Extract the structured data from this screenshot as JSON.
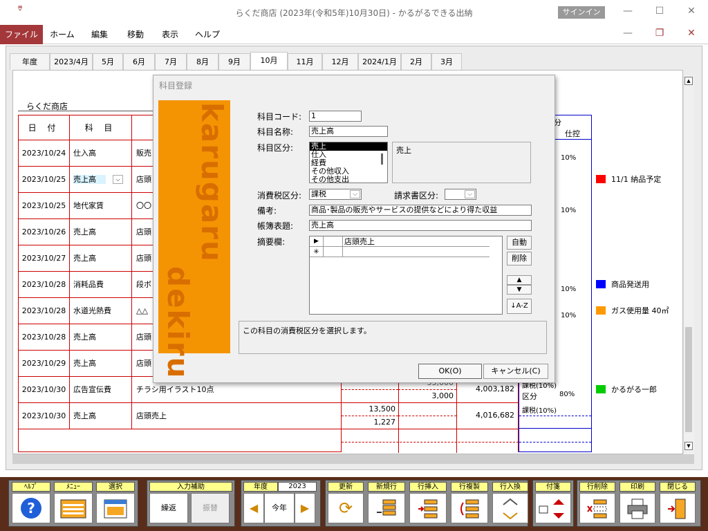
{
  "window": {
    "title": "らくだ商店 (2023年(令和5年)10月30日)  -  かるがるできる出納",
    "signin": "サインイン"
  },
  "ribbon": {
    "tabs": [
      "ファイル",
      "ホーム",
      "編集",
      "移動",
      "表示",
      "ヘルプ"
    ]
  },
  "month_tabs": [
    "年度",
    "2023/4月",
    "5月",
    "6月",
    "7月",
    "8月",
    "9月",
    "10月",
    "11月",
    "12月",
    "2024/1月",
    "2月",
    "3月"
  ],
  "active_month": "10月",
  "ledger": {
    "store_name": "らくだ商店",
    "col_date": "日 付",
    "col_item": "科 目",
    "rows": [
      {
        "date": "2023/10/24",
        "item": "仕入高",
        "desc": "販売"
      },
      {
        "date": "2023/10/25",
        "item": "売上高",
        "desc": "店頭"
      },
      {
        "date": "2023/10/25",
        "item": "地代家賃",
        "desc": "〇〇"
      },
      {
        "date": "2023/10/26",
        "item": "売上高",
        "desc": "店頭"
      },
      {
        "date": "2023/10/27",
        "item": "売上高",
        "desc": "店頭"
      },
      {
        "date": "2023/10/28",
        "item": "消耗品費",
        "desc": "段ボ"
      },
      {
        "date": "2023/10/28",
        "item": "水道光熱費",
        "desc": "△△"
      },
      {
        "date": "2023/10/28",
        "item": "売上高",
        "desc": "店頭"
      },
      {
        "date": "2023/10/29",
        "item": "売上高",
        "desc": "店頭"
      },
      {
        "date": "2023/10/30",
        "item": "広告宣伝費",
        "desc": "チラシ用イラスト10点"
      },
      {
        "date": "2023/10/30",
        "item": "売上高",
        "desc": "店頭売上"
      }
    ],
    "amounts": {
      "row10_a": "33,000",
      "row10_b": "3,000",
      "row10_bal": "4,003,182",
      "row11_a": "13,500",
      "row11_b": "1,227",
      "row11_bal": "4,016,682"
    },
    "right_col": {
      "header_a": "分",
      "header_b": "仕控",
      "p1": "10%",
      "p2": "10%",
      "p3": "10%",
      "p4": "10%",
      "tax1": "課税(10%)",
      "kubun": "区分",
      "pct": "80%",
      "tax2": "課税(10%)"
    }
  },
  "legend": [
    {
      "text": "11/1 納品予定",
      "color": "#ff0000"
    },
    {
      "text": "商品発送用",
      "color": "#0000ff"
    },
    {
      "text": "ガス使用量 40㎥",
      "color": "#ff9900"
    },
    {
      "text": "かるがる一郎",
      "color": "#00cc00"
    }
  ],
  "dialog": {
    "title": "科目登録",
    "brand_top": "karugaru",
    "brand_bottom": "dekiru",
    "code_label": "科目コード:",
    "code_value": "1",
    "name_label": "科目名称:",
    "name_value": "売上高",
    "kubun_label": "科目区分:",
    "kubun_options": [
      "売上",
      "仕入",
      "経費",
      "その他収入",
      "その他支出"
    ],
    "kubun_selected": "売上",
    "kubun_desc": "売上",
    "tax_label": "消費税区分:",
    "tax_value": "課税",
    "invoice_label": "請求書区分:",
    "invoice_value": "",
    "note_label": "備考:",
    "note_value": "商品･製品の販売やサービスの提供などにより得た収益",
    "book_label": "帳簿表題:",
    "book_value": "売上高",
    "tekiyo_label": "摘要欄:",
    "tekiyo_row": "店頭売上",
    "auto_button": "自動",
    "delete_button": "削除",
    "sort_icon": "↓A-Z",
    "hint": "この科目の消費税区分を選択します。",
    "ok_button": "OK(O)",
    "cancel_button": "キャンセル(C)"
  },
  "toolbar": {
    "help": "ﾍﾙﾌﾟ",
    "menu": "ﾒﾆｭｰ",
    "select": "選択",
    "input_assist": "入力補助",
    "repeat": "繰返",
    "transfer": "振替",
    "year_label": "年度",
    "year_value": "2023",
    "this_year": "今年",
    "update": "更新",
    "new_row": "新規行",
    "insert_row": "行挿入",
    "copy_row": "行複製",
    "swap_row": "行入換",
    "sticky": "付箋",
    "delete_row": "行削除",
    "print": "印刷",
    "close": "閉じる"
  }
}
